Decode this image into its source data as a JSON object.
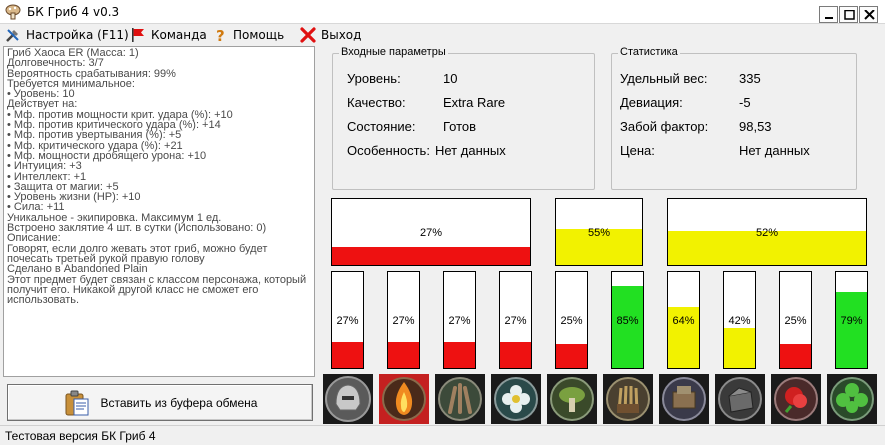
{
  "window": {
    "title": "БК Гриб 4 v0.3"
  },
  "menu": {
    "settings": "Настройка (F11)",
    "team": "Команда",
    "help": "Помощь",
    "exit": "Выход"
  },
  "item_info": {
    "lines": [
      "Гриб Хаоса  ER   (Масса: 1)",
      "Долговечность: 3/7",
      "Вероятность срабатывания: 99%",
      "Требуется минимальное:",
      "• Уровень: 10",
      "Действует на:",
      "• Мф. против мощности крит. удара (%): +10",
      "• Мф. против критического удара (%): +14",
      "• Мф. против увертывания (%): +5",
      "• Мф. критического удара (%): +21",
      "• Мф. мощности дробящего урона: +10",
      "• Интуиция: +3",
      "• Интеллект: +1",
      "• Защита от магии: +5",
      "• Уровень жизни (HP): +10",
      "• Сила: +11",
      "Уникальное - экипировка. Максимум 1 ед.",
      "Встроено заклятие  4 шт. в сутки (Использовано: 0)",
      "Описание:"
    ],
    "description": "Говорят, если долго жевать этот гриб, можно будет почесать третьей рукой правую голову",
    "made_in": "Сделано в Abandoned Plain",
    "binding": "Этот предмет будет связан с классом персонажа, который получит его. Никакой другой класс не сможет его использовать."
  },
  "paste_button": {
    "label": "Вставить из буфера обмена"
  },
  "input_params": {
    "title": "Входные параметры",
    "rows": [
      {
        "label": "Уровень:",
        "value": "10"
      },
      {
        "label": "Качество:",
        "value": "Extra Rare"
      },
      {
        "label": "Состояние:",
        "value": "Готов"
      },
      {
        "label": "Особенность:",
        "value": "Нет данных"
      }
    ]
  },
  "stats": {
    "title": "Статистика",
    "rows": [
      {
        "label": "Удельный вес:",
        "value": "335"
      },
      {
        "label": "Девиация:",
        "value": "-5"
      },
      {
        "label": "Забой фактор:",
        "value": "98,53"
      },
      {
        "label": "Цена:",
        "value": "Нет данных"
      }
    ]
  },
  "colors": {
    "red": "#ee1111",
    "yellow": "#f2f200",
    "green": "#22e022"
  },
  "big_bars": [
    {
      "label": "27%",
      "value": 27,
      "color": "red"
    },
    {
      "label": "55%",
      "value": 55,
      "color": "yellow"
    },
    {
      "label": "52%",
      "value": 52,
      "color": "yellow"
    }
  ],
  "small_bars": [
    {
      "label": "27%",
      "value": 27,
      "color": "red"
    },
    {
      "label": "27%",
      "value": 27,
      "color": "red"
    },
    {
      "label": "27%",
      "value": 27,
      "color": "red"
    },
    {
      "label": "27%",
      "value": 27,
      "color": "red"
    },
    {
      "label": "25%",
      "value": 25,
      "color": "red"
    },
    {
      "label": "85%",
      "value": 85,
      "color": "green"
    },
    {
      "label": "64%",
      "value": 64,
      "color": "yellow"
    },
    {
      "label": "42%",
      "value": 42,
      "color": "yellow"
    },
    {
      "label": "25%",
      "value": 25,
      "color": "red"
    },
    {
      "label": "79%",
      "value": 79,
      "color": "green"
    }
  ],
  "slots": [
    {
      "icon": "helmet-icon",
      "active": false
    },
    {
      "icon": "flame-icon",
      "active": true
    },
    {
      "icon": "claw-icon",
      "active": false
    },
    {
      "icon": "flower-icon",
      "active": false
    },
    {
      "icon": "mushroom-icon",
      "active": false
    },
    {
      "icon": "quiver-icon",
      "active": false
    },
    {
      "icon": "gear-icon",
      "active": false
    },
    {
      "icon": "bag-icon",
      "active": false
    },
    {
      "icon": "rose-icon",
      "active": false
    },
    {
      "icon": "clover-icon",
      "active": false
    },
    {
      "icon": "berry-icon",
      "active": false
    }
  ],
  "statusbar": {
    "text": "Тестовая версия БК Гриб 4"
  }
}
